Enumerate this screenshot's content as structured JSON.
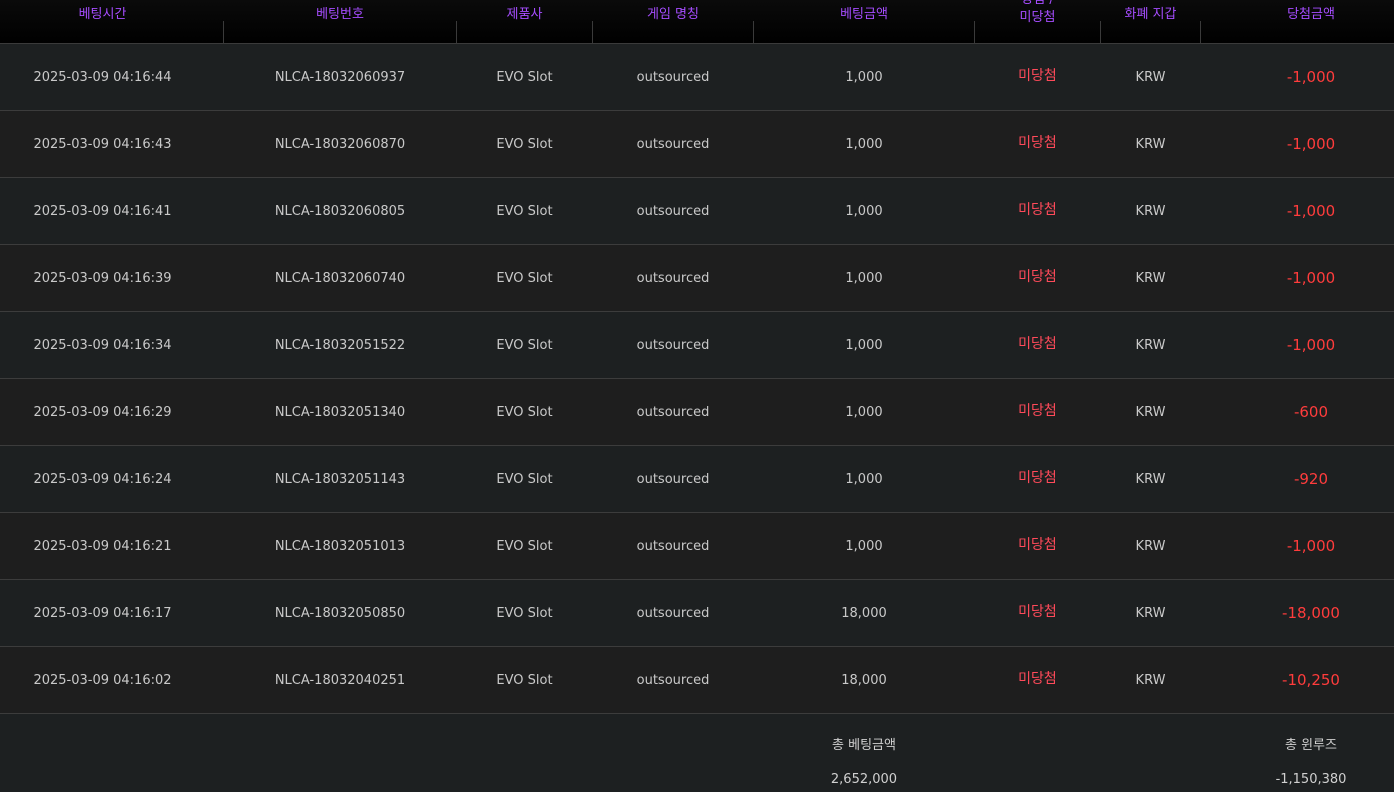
{
  "columns": [
    {
      "label": "베팅시간"
    },
    {
      "label": "베팅번호"
    },
    {
      "label": "제품사"
    },
    {
      "label": "게임 명칭"
    },
    {
      "label": "베팅금액"
    },
    {
      "label_line1": "당첨 /",
      "label_line2": "미당첨"
    },
    {
      "label": "화폐 지갑"
    },
    {
      "label": "당첨금액"
    }
  ],
  "rows": [
    {
      "time": "2025-03-09 04:16:44",
      "bet_id": "NLCA-18032060937",
      "provider": "EVO Slot",
      "game": "outsourced",
      "bet": "1,000",
      "status": "미당첨",
      "currency": "KRW",
      "win": "-1,000"
    },
    {
      "time": "2025-03-09 04:16:43",
      "bet_id": "NLCA-18032060870",
      "provider": "EVO Slot",
      "game": "outsourced",
      "bet": "1,000",
      "status": "미당첨",
      "currency": "KRW",
      "win": "-1,000"
    },
    {
      "time": "2025-03-09 04:16:41",
      "bet_id": "NLCA-18032060805",
      "provider": "EVO Slot",
      "game": "outsourced",
      "bet": "1,000",
      "status": "미당첨",
      "currency": "KRW",
      "win": "-1,000"
    },
    {
      "time": "2025-03-09 04:16:39",
      "bet_id": "NLCA-18032060740",
      "provider": "EVO Slot",
      "game": "outsourced",
      "bet": "1,000",
      "status": "미당첨",
      "currency": "KRW",
      "win": "-1,000"
    },
    {
      "time": "2025-03-09 04:16:34",
      "bet_id": "NLCA-18032051522",
      "provider": "EVO Slot",
      "game": "outsourced",
      "bet": "1,000",
      "status": "미당첨",
      "currency": "KRW",
      "win": "-1,000"
    },
    {
      "time": "2025-03-09 04:16:29",
      "bet_id": "NLCA-18032051340",
      "provider": "EVO Slot",
      "game": "outsourced",
      "bet": "1,000",
      "status": "미당첨",
      "currency": "KRW",
      "win": "-600"
    },
    {
      "time": "2025-03-09 04:16:24",
      "bet_id": "NLCA-18032051143",
      "provider": "EVO Slot",
      "game": "outsourced",
      "bet": "1,000",
      "status": "미당첨",
      "currency": "KRW",
      "win": "-920"
    },
    {
      "time": "2025-03-09 04:16:21",
      "bet_id": "NLCA-18032051013",
      "provider": "EVO Slot",
      "game": "outsourced",
      "bet": "1,000",
      "status": "미당첨",
      "currency": "KRW",
      "win": "-1,000"
    },
    {
      "time": "2025-03-09 04:16:17",
      "bet_id": "NLCA-18032050850",
      "provider": "EVO Slot",
      "game": "outsourced",
      "bet": "18,000",
      "status": "미당첨",
      "currency": "KRW",
      "win": "-18,000"
    },
    {
      "time": "2025-03-09 04:16:02",
      "bet_id": "NLCA-18032040251",
      "provider": "EVO Slot",
      "game": "outsourced",
      "bet": "18,000",
      "status": "미당첨",
      "currency": "KRW",
      "win": "-10,250"
    }
  ],
  "footer": {
    "total_bet_label": "총 베팅금액",
    "total_bet_value": "2,652,000",
    "total_winloss_label": "총 윈루즈",
    "total_winloss_value": "-1,150,380"
  },
  "colors": {
    "header_text": "#a64dff",
    "status_text": "#ff4a5a",
    "negative_amount": "#ff3c3c"
  }
}
